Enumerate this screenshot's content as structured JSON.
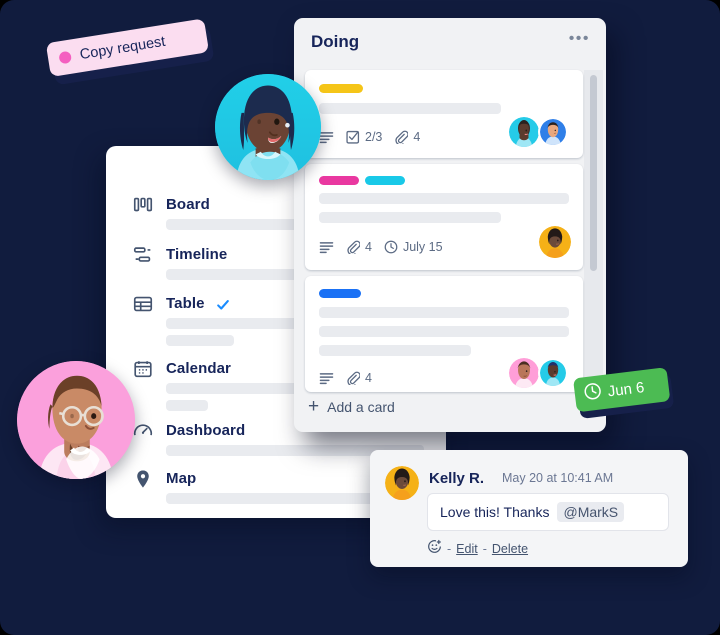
{
  "background_color": "#111c3e",
  "copy_pill": {
    "label": "Copy request",
    "dot_color": "#f45fc0",
    "bg_color": "#fbddf0",
    "icon": "dot-icon"
  },
  "due_pill": {
    "label": "Jun 6",
    "bg_color": "#4cbb53",
    "icon": "clock-icon"
  },
  "views_panel": {
    "items": [
      {
        "label": "Board",
        "icon": "board-icon",
        "checked": false
      },
      {
        "label": "Timeline",
        "icon": "timeline-icon",
        "checked": false
      },
      {
        "label": "Table",
        "icon": "table-icon",
        "checked": true
      },
      {
        "label": "Calendar",
        "icon": "calendar-icon",
        "checked": false
      },
      {
        "label": "Dashboard",
        "icon": "dashboard-icon",
        "checked": false
      },
      {
        "label": "Map",
        "icon": "map-pin-icon",
        "checked": false
      }
    ],
    "check_color": "#1a8cff"
  },
  "doing_list": {
    "title": "Doing",
    "menu_icon": "ellipsis-icon",
    "add_card_label": "Add a card",
    "add_card_icon": "plus-icon",
    "cards": [
      {
        "labels": [
          "#f5c518"
        ],
        "description_icon": "description-icon",
        "checklist_icon": "checklist-icon",
        "checklist": "2/3",
        "attachment_icon": "attachment-icon",
        "attachments": "4",
        "due": "",
        "members": [
          "teal-avatar",
          "blue-avatar"
        ]
      },
      {
        "labels": [
          "#e938a0",
          "#19c9e8"
        ],
        "description_icon": "description-icon",
        "checklist": "",
        "attachment_icon": "attachment-icon",
        "attachments": "4",
        "due_icon": "clock-icon",
        "due": "July 15",
        "members": [
          "yellow-avatar"
        ]
      },
      {
        "labels": [
          "#1a71f5"
        ],
        "description_icon": "description-icon",
        "checklist": "",
        "attachment_icon": "attachment-icon",
        "attachments": "4",
        "due": "",
        "members": [
          "pink-avatar",
          "cyan-avatar"
        ]
      }
    ]
  },
  "comment": {
    "author": "Kelly R.",
    "timestamp": "May 20 at 10:41 AM",
    "body": "Love this! Thanks",
    "mention": "@MarkS",
    "emoji_icon": "add-reaction-icon",
    "separator": "-",
    "edit_label": "Edit",
    "delete_label": "Delete",
    "avatar": "yellow-avatar"
  }
}
